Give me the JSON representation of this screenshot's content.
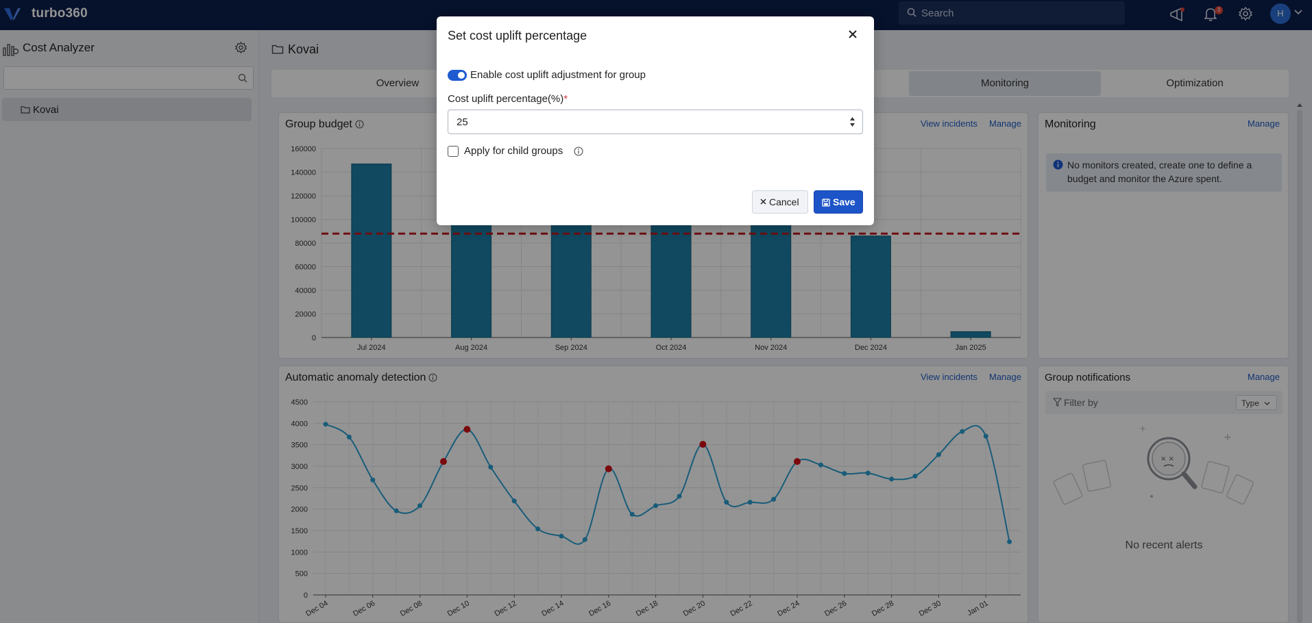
{
  "app": {
    "brand": "turbo360"
  },
  "topbar": {
    "search_placeholder": "Search",
    "notifications_count": "3",
    "avatar_initial": "H"
  },
  "sidebar": {
    "title": "Cost Analyzer",
    "search_value": "",
    "items": [
      {
        "label": "Kovai"
      }
    ]
  },
  "main": {
    "title": "Kovai",
    "tabs": [
      {
        "label": "Overview",
        "active": false
      },
      {
        "label": "Monitoring",
        "active": true
      },
      {
        "label": "Optimization",
        "active": false
      }
    ]
  },
  "panels": {
    "budget": {
      "title": "Group budget",
      "view_incidents": "View incidents",
      "manage": "Manage"
    },
    "anomaly": {
      "title": "Automatic anomaly detection",
      "view_incidents": "View incidents",
      "manage": "Manage"
    },
    "monitoring": {
      "title": "Monitoring",
      "manage": "Manage",
      "note": "No monitors created, create one to define a budget and monitor the Azure spent."
    },
    "notifications": {
      "title": "Group notifications",
      "manage": "Manage",
      "filter_placeholder": "Filter by",
      "type_select": "Type",
      "empty": "No recent alerts"
    }
  },
  "modal": {
    "title": "Set cost uplift percentage",
    "toggle_label": "Enable cost uplift adjustment for group",
    "toggle_on": true,
    "field_label": "Cost uplift percentage(%)",
    "required_mark": "*",
    "field_value": "25",
    "checkbox_label": "Apply for child groups",
    "checkbox_checked": false,
    "cancel_label": "Cancel",
    "save_label": "Save"
  },
  "colors": {
    "topbar": "#0c1e4a",
    "bar": "#1d7ea6",
    "budget_line": "#c0171e",
    "anomaly_line": "#2a9fd0",
    "anomaly_point": "#d40f19",
    "primary": "#1d54c7"
  },
  "icons": [
    "search-icon",
    "megaphone-icon",
    "bell-icon",
    "gear-icon",
    "folder-icon",
    "info-icon",
    "filter-icon",
    "close-icon",
    "save-icon",
    "chevron-left-icon"
  ],
  "chart_data": [
    {
      "type": "bar",
      "categories": [
        "Jul 2024",
        "Aug 2024",
        "Sep 2024",
        "Oct 2024",
        "Nov 2024",
        "Dec 2024",
        "Jan 2025"
      ],
      "values": [
        147000,
        125000,
        125000,
        125000,
        125000,
        86000,
        5000
      ],
      "yticks": [
        0,
        20000,
        40000,
        60000,
        80000,
        100000,
        120000,
        140000,
        160000
      ],
      "ylim": [
        0,
        160000
      ],
      "budget_line": 88000,
      "grid": true
    },
    {
      "type": "line",
      "x": [
        "Dec 04",
        "Dec 05",
        "Dec 06",
        "Dec 07",
        "Dec 08",
        "Dec 09",
        "Dec 10",
        "Dec 11",
        "Dec 12",
        "Dec 13",
        "Dec 14",
        "Dec 15",
        "Dec 16",
        "Dec 17",
        "Dec 18",
        "Dec 19",
        "Dec 20",
        "Dec 21",
        "Dec 22",
        "Dec 23",
        "Dec 24",
        "Dec 25",
        "Dec 26",
        "Dec 27",
        "Dec 28",
        "Dec 29",
        "Dec 30",
        "Dec 31",
        "Jan 01",
        "Jan 02"
      ],
      "values": [
        3980,
        3680,
        2680,
        1960,
        2080,
        3110,
        3860,
        2980,
        2190,
        1540,
        1370,
        1290,
        2940,
        1880,
        2080,
        2300,
        3510,
        2160,
        2160,
        2230,
        3110,
        3030,
        2830,
        2840,
        2700,
        2770,
        3270,
        3810,
        3700,
        1240
      ],
      "anomalies": [
        5,
        6,
        12,
        16,
        20
      ],
      "xtick_labels": [
        "Dec 04",
        "Dec 06",
        "Dec 08",
        "Dec 10",
        "Dec 12",
        "Dec 14",
        "Dec 16",
        "Dec 18",
        "Dec 20",
        "Dec 22",
        "Dec 24",
        "Dec 26",
        "Dec 28",
        "Dec 30",
        "Jan 01"
      ],
      "yticks": [
        0,
        500,
        1000,
        1500,
        2000,
        2500,
        3000,
        3500,
        4000,
        4500
      ],
      "ylim": [
        0,
        4500
      ],
      "grid": true
    }
  ]
}
